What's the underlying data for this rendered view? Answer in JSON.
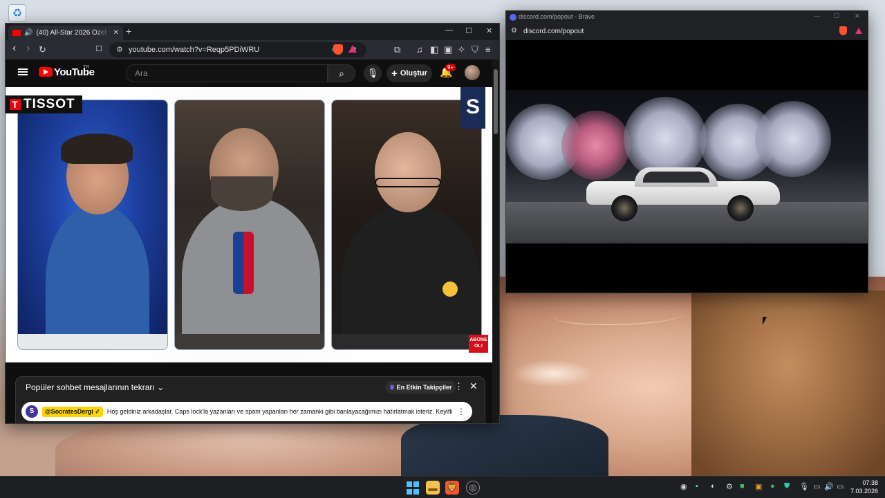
{
  "desktop": {
    "recycle_bin_icon": "recycle-bin-icon"
  },
  "youtube_window": {
    "tab": {
      "title": "(40) All-Star 2026 Özel: Alper...",
      "audio_icon": "🔊",
      "close": "✕"
    },
    "new_tab": "+",
    "controls": {
      "minimize": "—",
      "maximize": "☐",
      "close": "✕"
    },
    "nav": {
      "back": "‹",
      "forward": "›",
      "reload": "↻",
      "bookmark": "☐"
    },
    "url": "youtube.com/watch?v=Reqp5PDiWRU",
    "header": {
      "logo_text": "YouTube",
      "country": "TR",
      "search_placeholder": "Ara",
      "create_label": "Oluştur",
      "notifications_badge": "9+"
    },
    "video": {
      "sponsor": "TISSOT",
      "sponsor_prefix": "T",
      "channel_mark": "S",
      "subscribe_overlay": "ABONE OL!"
    },
    "chat": {
      "title": "Popüler sohbet mesajlarının tekrarı",
      "filter_chip": "En Etkin Takipçiler",
      "pinned": {
        "author": "@SocratesDergi",
        "text": "Hoş geldiniz arkadaşlar. Caps lock'la yazanları ve spam yapanları her zamanki gibi banlayacağımızı hatırlatmak isteriz. Keyifli ..."
      }
    }
  },
  "discord_window": {
    "title": "discord.com/popout - Brave",
    "url": "discord.com/popout",
    "controls": {
      "minimize": "—",
      "maximize": "☐",
      "close": "✕"
    }
  },
  "taskbar": {
    "time": "07:38",
    "date": "7.03.2026"
  },
  "colors": {
    "youtube_red": "#ff0000",
    "brave_orange": "#fb542b",
    "windows_blue": "#4cc2ff"
  }
}
